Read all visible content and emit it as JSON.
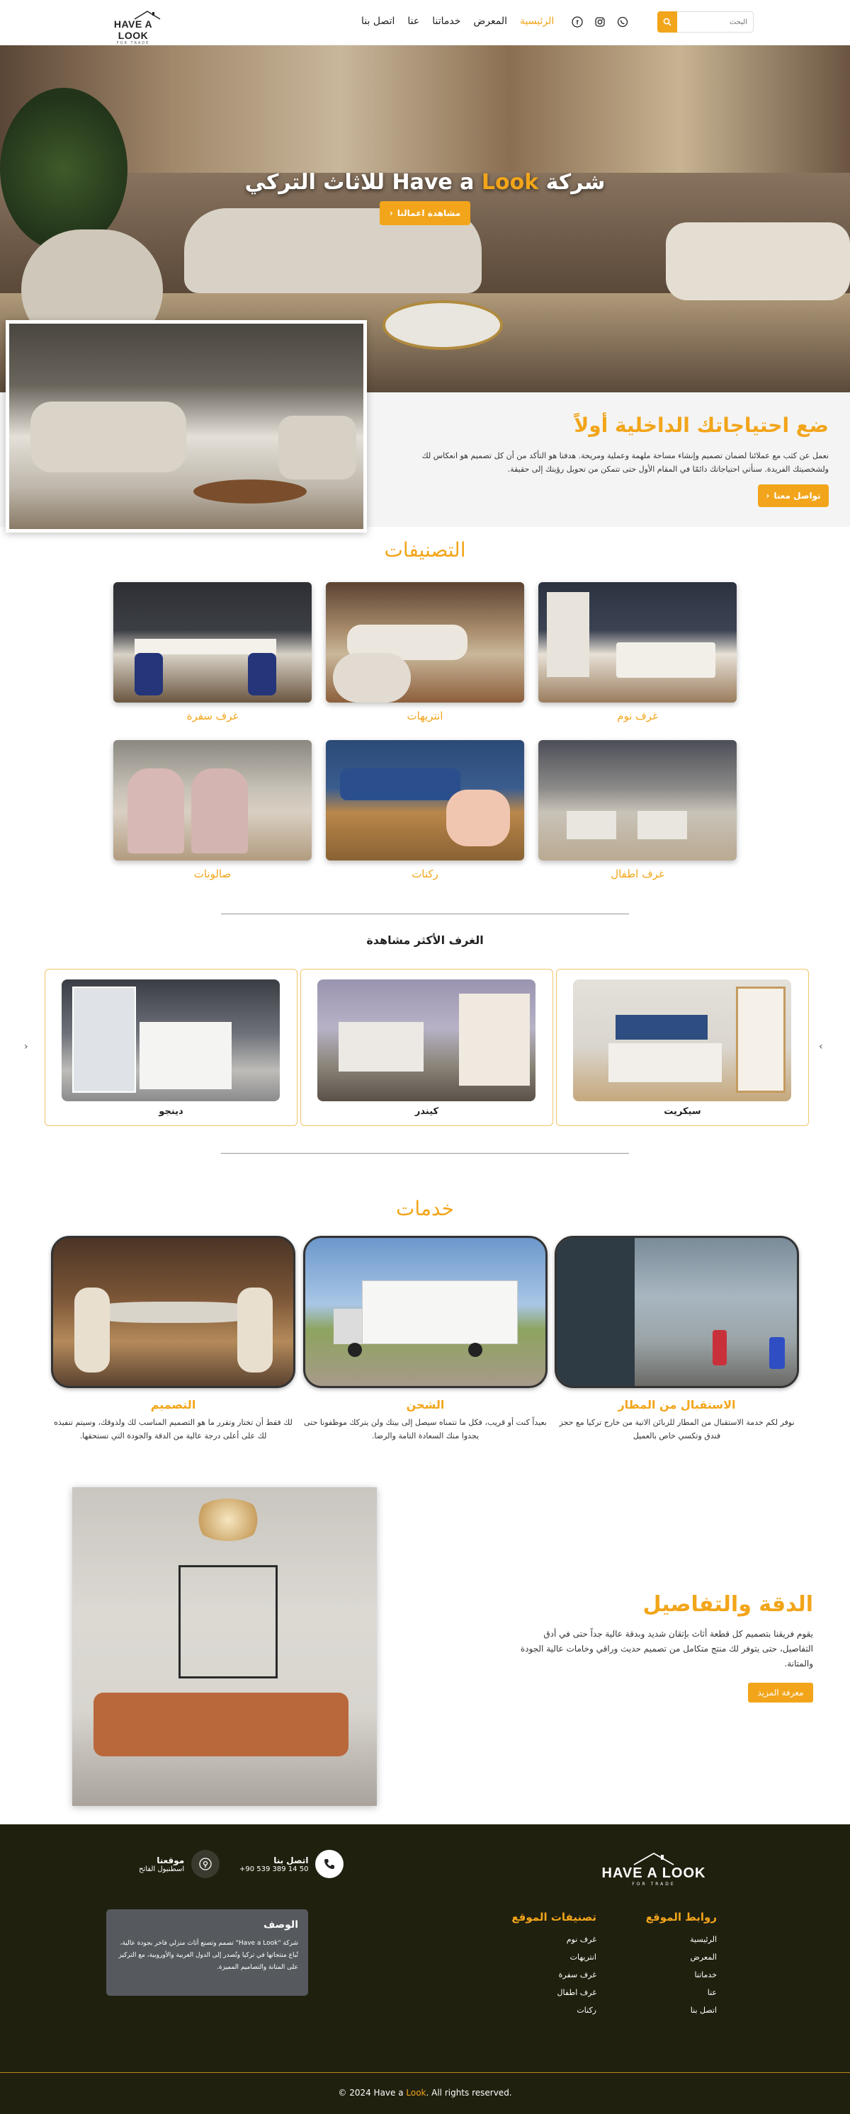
{
  "header": {
    "search_placeholder": "البحث",
    "nav": [
      "الرئيسية",
      "المعرض",
      "خدماتنا",
      "عنا",
      "اتصل بنا"
    ],
    "logo": {
      "text_left": "HAVE A ",
      "text_right": "LOOK",
      "sub": "FOR TRADE"
    }
  },
  "hero": {
    "title_prefix": "شركة ",
    "title_brand_a": "Have a ",
    "title_brand_b": "Look",
    "title_suffix": " للاثاث التركي",
    "button": "مشاهدة اعمالنا"
  },
  "intro": {
    "title": "ضع احتياجاتك الداخلية أولاً",
    "text": "نعمل عن كثب مع عملائنا لضمان تصميم وإنشاء مساحة ملهمة وعملية ومريحة. هدفنا هو التأكد من أن كل تصميم هو انعكاس لك ولشخصيتك الفريدة. سنأتي احتياجاتك دائمًا في المقام الأول حتى تتمكن من تحويل رؤيتك إلى حقيقة.",
    "button": "تواصل معنا"
  },
  "categories": {
    "title": "التصنيفات",
    "items": [
      "غرف نوم",
      "انتريهات",
      "غرف سفرة",
      "غرف اطفال",
      "ركنات",
      "صالونات"
    ]
  },
  "most_viewed": {
    "title": "الغرف الأكثر مشاهدة",
    "items": [
      "سيكريت",
      "كيندر",
      "دينجو"
    ]
  },
  "services": {
    "title": "خدمات",
    "items": [
      {
        "title": "الاستقبال من المطار",
        "text": "نوفر لكم خدمة الاستقبال من المطار للزبائن الاتية من خارج تركيا مع حجز فندق وتكسي خاص بالعميل"
      },
      {
        "title": "الشحن",
        "text": "بعيداً كنت أو قريب، فكل ما تتمناه سيصل إلى بيتك ولن يتركك موظفونا حتى يجدوا منك السعادة التامة والرضا."
      },
      {
        "title": "التصميم",
        "text": "لك فقط أن تختار وتقرر ما هو التصميم المناسب لك ولذوقك، وسيتم تنفيذه لك على أعلى درجة عالية من الدقة والجودة التي تستحقها."
      }
    ]
  },
  "precision": {
    "title": "الدقة والتفاصيل",
    "text": "يقوم فريقنا بتصميم كل قطعة أثاث بإتقان شديد وبدقة عالية جداً حتى في أدق التفاصيل، حتى يتوفر لك منتج متكامل من تصميم حديث وراقي وخامات عالية الجودة والمتانة.",
    "button": "معرفة المزيد"
  },
  "footer": {
    "contact_title": "اتصل بنا",
    "contact_phone": "+90 539 389 14 50",
    "location_title": "موقعنا",
    "location_text": "اسطنبول الفاتح",
    "links_title": "روابط الموقع",
    "links": [
      "الرئيسية",
      "المعرض",
      "خدماتنا",
      "عنا",
      "اتصل بنا"
    ],
    "cats_title": "تصنيفات الموقع",
    "cats": [
      "غرف نوم",
      "انتريهات",
      "غرف سفرة",
      "غرف اطفال",
      "ركنات"
    ],
    "desc_title": "الوصف",
    "desc_text": "شركة \"Have a Look\" تصمم وتصنع أثاث منزلي فاخر بجودة عالية، تُباع منتجاتها في تركيا وتُصدر إلى الدول العربية والأوروبية، مع التركيز على المتانة والتصاميم المميزة.",
    "copyright_a": "© 2024 Have a ",
    "copyright_b": "Look",
    "copyright_c": ". All rights reserved."
  },
  "colors": {
    "accent": "#f2a51a",
    "footer_bg": "#20200f"
  }
}
